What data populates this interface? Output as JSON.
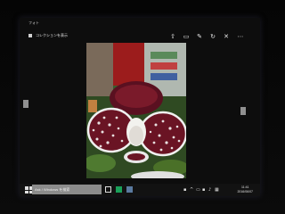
{
  "window": {
    "title": "フォト",
    "breadcrumb": "コレクションを表示"
  },
  "toolbar": {
    "buttons": [
      {
        "name": "share-icon",
        "glyph": "⇧"
      },
      {
        "name": "slideshow-icon",
        "glyph": "▭"
      },
      {
        "name": "edit-icon",
        "glyph": "✎"
      },
      {
        "name": "rotate-icon",
        "glyph": "↻"
      },
      {
        "name": "delete-icon",
        "glyph": "🗑"
      },
      {
        "name": "more-icon",
        "glyph": "⋯"
      }
    ]
  },
  "taskbar": {
    "search_placeholder": "Ask / Windows を検索",
    "clock_time": "11:41",
    "clock_date": "2016/06/07"
  },
  "colors": {
    "accent": "#1aa05a",
    "window_bg": "#0d0d0d",
    "taskbar_bg": "#121212"
  }
}
